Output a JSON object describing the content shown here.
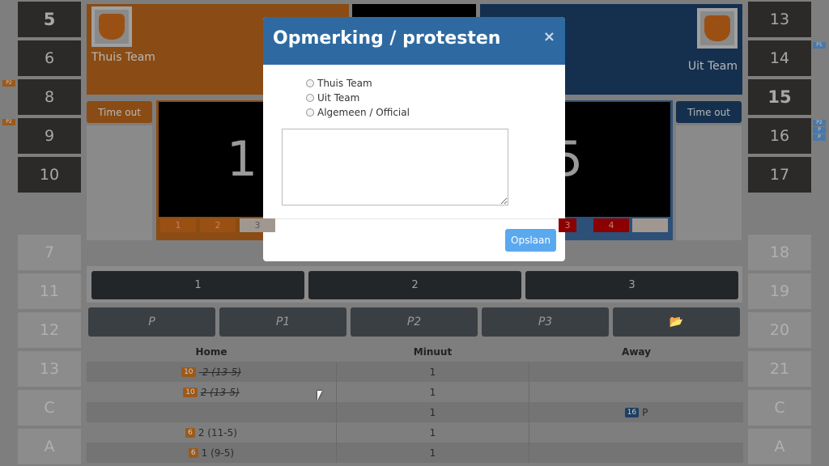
{
  "home": {
    "name": "Thuis Team",
    "color": "#e8801e",
    "score": "1",
    "timeout": "Time out",
    "periods": [
      "1",
      "2",
      "3"
    ],
    "players": [
      {
        "n": "5",
        "bold": true
      },
      {
        "n": "6"
      },
      {
        "n": "8",
        "foul": "P2"
      },
      {
        "n": "9",
        "foul": "P2"
      },
      {
        "n": "10"
      }
    ],
    "bench": [
      "7",
      "11",
      "12",
      "13",
      "C",
      "A"
    ]
  },
  "away": {
    "name": "Uit Team",
    "color": "#2a6099",
    "score": "5",
    "timeout": "Time out",
    "periods": [
      "3",
      "4",
      ""
    ],
    "players": [
      {
        "n": "13"
      },
      {
        "n": "14",
        "fouls": [
          "P1"
        ]
      },
      {
        "n": "15",
        "bold": true
      },
      {
        "n": "16",
        "fouls": [
          "P2",
          "P",
          "P"
        ]
      },
      {
        "n": "17"
      }
    ],
    "bench": [
      "18",
      "19",
      "20",
      "21",
      "C",
      "A"
    ]
  },
  "period_tabs": [
    "1",
    "2",
    "3"
  ],
  "quarter_buttons": [
    "P",
    "P1",
    "P2",
    "P3"
  ],
  "folder_icon": "folder-open-icon",
  "table": {
    "headers": [
      "Home",
      "Minuut",
      "Away"
    ],
    "rows": [
      {
        "home_badge": "10",
        "home": "-2 (13-5)",
        "strike": true,
        "minute": "1",
        "away_badge": "",
        "away": ""
      },
      {
        "home_badge": "10",
        "home": "2 (13-5)",
        "strike": true,
        "minute": "1",
        "away_badge": "",
        "away": ""
      },
      {
        "home_badge": "",
        "home": "",
        "strike": false,
        "minute": "1",
        "away_badge": "16",
        "away": "P"
      },
      {
        "home_badge": "6",
        "home": "2 (11-5)",
        "strike": false,
        "minute": "1",
        "away_badge": "",
        "away": ""
      },
      {
        "home_badge": "6",
        "home": "1 (9-5)",
        "strike": false,
        "minute": "1",
        "away_badge": "",
        "away": ""
      }
    ]
  },
  "modal": {
    "title": "Opmerking / protesten",
    "close": "×",
    "options": [
      "Thuis Team",
      "Uit Team",
      "Algemeen / Official"
    ],
    "textarea_value": "",
    "save": "Opslaan"
  }
}
